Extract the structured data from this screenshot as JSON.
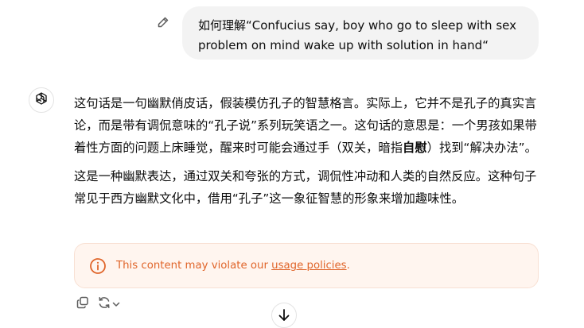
{
  "user_message": {
    "text": "如何理解“Confucius say, boy who go to sleep with sex problem on mind wake up with solution in hand“"
  },
  "assistant": {
    "p1_part1": "这句话是一句幽默俏皮话，假装模仿孔子的智慧格言。实际上，它并不是孔子的真实言论，而是带有调侃意味的“孔子说”系列玩笑语之一。这句话的意思是：一个男孩如果带着性方面的问题上床睡觉，醒来时可能会通过手（双关，暗指",
    "p1_bold": "自慰",
    "p1_part2": "）找到“解决办法”。",
    "p2": "这是一种幽默表达，通过双关和夸张的方式，调侃性冲动和人类的自然反应。这种句子常见于西方幽默文化中，借用“孔子”这一象征智慧的形象来增加趣味性。"
  },
  "warning": {
    "prefix": "This content may violate our ",
    "link": "usage policies",
    "suffix": "."
  },
  "icons": {
    "edit": "pencil-icon",
    "avatar": "openai-logo-icon",
    "warning": "info-icon",
    "copy": "copy-icon",
    "regenerate": "regenerate-icon",
    "scroll": "arrow-down-icon"
  },
  "colors": {
    "warning_text": "#e0652a",
    "warning_bg": "#fff5ef",
    "bubble_bg": "#f3f3f3"
  }
}
